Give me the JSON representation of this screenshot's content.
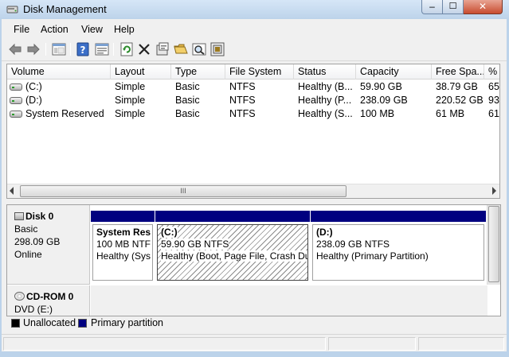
{
  "window": {
    "title": "Disk Management",
    "controls": {
      "minimize": "‒",
      "maximize": "☐",
      "close": "✕"
    }
  },
  "menu": [
    "File",
    "Action",
    "View",
    "Help"
  ],
  "toolbar": [
    "back-arrow-icon",
    "forward-arrow-icon",
    "console-tree-icon",
    "help-icon",
    "properties-icon",
    "refresh-icon",
    "delete-icon",
    "settings-icon",
    "open-folder-icon",
    "search-icon",
    "disk-properties-icon"
  ],
  "volume_table": {
    "columns": [
      "Volume",
      "Layout",
      "Type",
      "File System",
      "Status",
      "Capacity",
      "Free Spa...",
      "% F"
    ],
    "rows": [
      {
        "volume": "(C:)",
        "layout": "Simple",
        "type": "Basic",
        "fs": "NTFS",
        "status": "Healthy (B...",
        "capacity": "59.90 GB",
        "free": "38.79 GB",
        "pct": "65"
      },
      {
        "volume": "(D:)",
        "layout": "Simple",
        "type": "Basic",
        "fs": "NTFS",
        "status": "Healthy (P...",
        "capacity": "238.09 GB",
        "free": "220.52 GB",
        "pct": "93"
      },
      {
        "volume": "System Reserved",
        "layout": "Simple",
        "type": "Basic",
        "fs": "NTFS",
        "status": "Healthy (S...",
        "capacity": "100 MB",
        "free": "61 MB",
        "pct": "61"
      }
    ],
    "scroll_grip": "III"
  },
  "disks": [
    {
      "name": "Disk 0",
      "type": "Basic",
      "size": "298.09 GB",
      "state": "Online",
      "partitions": [
        {
          "label": "System Res",
          "size": "100 MB NTF",
          "status": "Healthy (Sys"
        },
        {
          "label": "(C:)",
          "size": "59.90 GB NTFS",
          "status": "Healthy (Boot, Page File, Crash Du"
        },
        {
          "label": "(D:)",
          "size": "238.09 GB NTFS",
          "status": "Healthy (Primary Partition)"
        }
      ]
    },
    {
      "name": "CD-ROM 0",
      "type": "DVD (E:)"
    }
  ],
  "legend": [
    {
      "label": "Unallocated",
      "color": "#000000"
    },
    {
      "label": "Primary partition",
      "color": "#000080"
    }
  ],
  "colors": {
    "partition_bar": "#000080",
    "title_bar": "#bcd3ea"
  }
}
